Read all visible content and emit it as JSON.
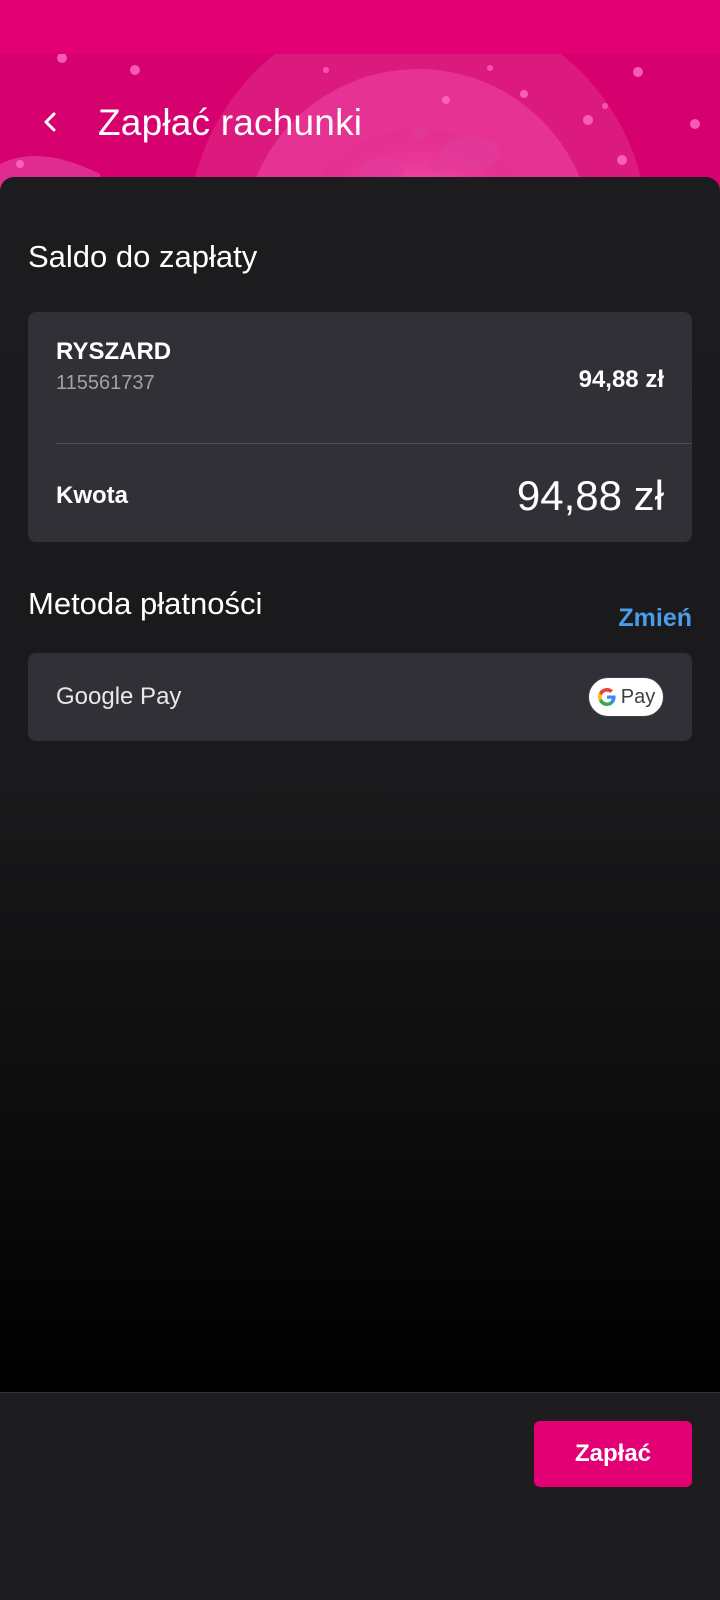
{
  "header": {
    "title": "Zapłać rachunki",
    "back_icon": "chevron-left-icon",
    "brand_color": "#E20074"
  },
  "balance": {
    "section_title": "Saldo do zapłaty",
    "account": {
      "name": "RYSZARD",
      "number": "115561737",
      "amount": "94,88 zł"
    },
    "total_label": "Kwota",
    "total_value": "94,88 zł"
  },
  "payment_method": {
    "section_title": "Metoda płatności",
    "change_label": "Zmień",
    "selected": "Google Pay",
    "badge_icon": "google-pay-icon",
    "badge_text": "Pay"
  },
  "footer": {
    "pay_label": "Zapłać"
  },
  "colors": {
    "accent": "#E20074",
    "link": "#4A9DE6",
    "card": "#313036"
  }
}
